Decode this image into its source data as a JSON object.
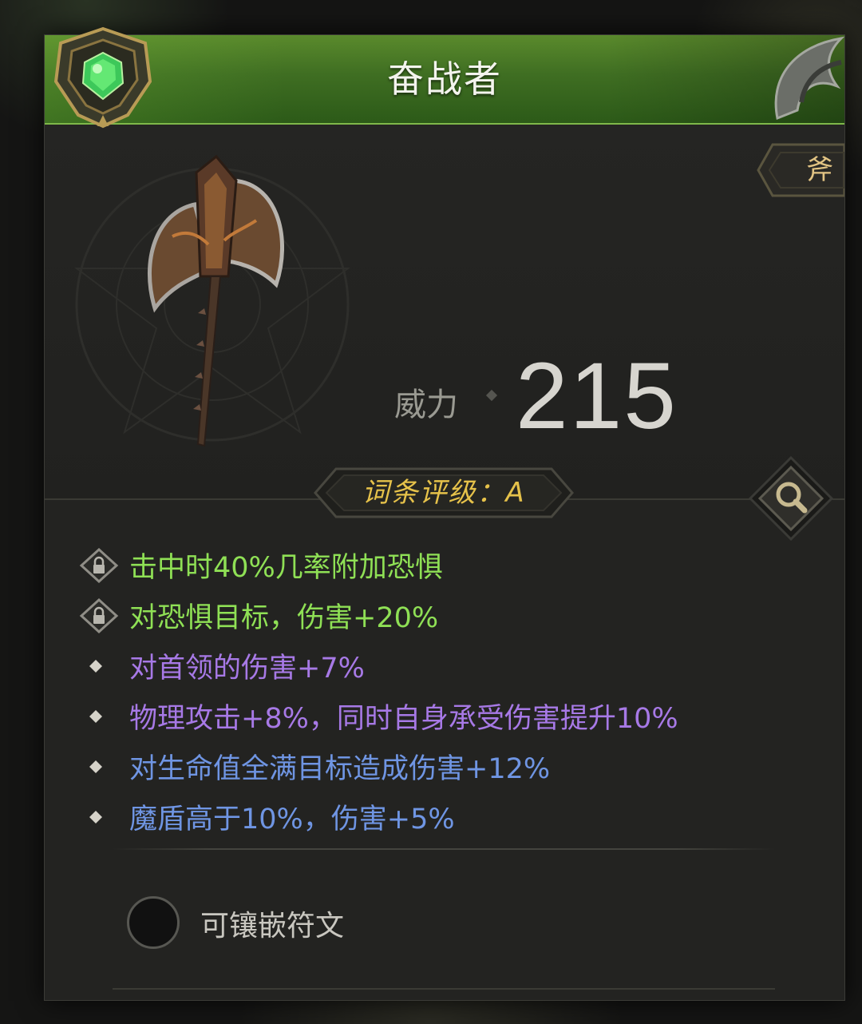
{
  "item": {
    "name": "奋战者",
    "type": "斧",
    "power_label": "威力",
    "power_value": "215",
    "grade_text": "词条评级：A"
  },
  "affixes": [
    {
      "text": "击中时40%几率附加恐惧",
      "locked": true,
      "color": "#8fe055"
    },
    {
      "text": "对恐惧目标，伤害+20%",
      "locked": true,
      "color": "#8fe055"
    },
    {
      "text": "对首领的伤害+7%",
      "locked": false,
      "color": "#a779e6"
    },
    {
      "text": "物理攻击+8%，同时自身承受伤害提升10%",
      "locked": false,
      "color": "#a779e6"
    },
    {
      "text": "对生命值全满目标造成伤害+12%",
      "locked": false,
      "color": "#6f95e3"
    },
    {
      "text": "魔盾高于10%，伤害+5%",
      "locked": false,
      "color": "#6f95e3"
    }
  ],
  "rune": {
    "label": "可镶嵌符文"
  },
  "icons": {
    "emblem": "green-gem-emblem-icon",
    "search": "magnifier-icon",
    "lock": "lock-icon",
    "bullet": "diamond-bullet-icon",
    "weapon": "axe-icon"
  },
  "colors": {
    "header_green": "#4a7a26",
    "grade_gold": "#e6c24a",
    "type_gold": "#e2c483"
  }
}
